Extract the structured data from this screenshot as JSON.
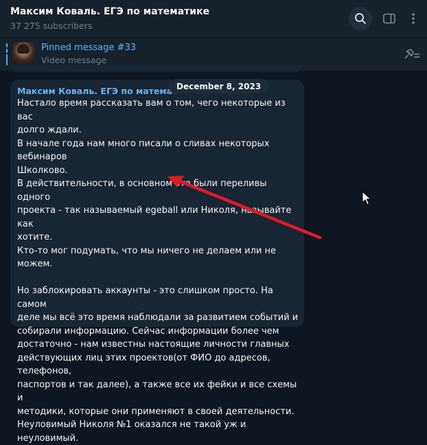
{
  "header": {
    "channel_name": "Максим Коваль. ЕГЭ по математике",
    "subscribers": "37 275 subscribers",
    "icons": [
      "search-icon",
      "sidebar-toggle-icon",
      "more-vertical-icon"
    ]
  },
  "pinned": {
    "title": "Pinned message #33",
    "subtitle": "Video message",
    "icon": "unpin-icon"
  },
  "date_badge": "December 8, 2023",
  "message": {
    "sender": "Максим Коваль. ЕГЭ по математике",
    "lines": [
      "Настало время рассказать вам о том, чего некоторые из вас",
      "долго ждали.",
      "В начале года нам много писали о сливах некоторых вебинаров",
      "Школково.",
      "В действительности, в основном это были переливы одного",
      "проекта - так называемый egeball или Николя, называйте как",
      "хотите.",
      "Кто-то мог подумать, что мы ничего не делаем или не можем.",
      "",
      "Но заблокировать аккаунты - это слишком просто. На самом",
      "деле мы всё это время наблюдали за развитием событий и",
      "собирали информацию. Сейчас информации более чем",
      "достаточно - нам известны настоящие личности главных",
      "действующих лиц этих проектов(от ФИО до адресов, телефонов,",
      "паспортов и так далее), а также все их фейки и все схемы и",
      "методики, которые они применяют в своей деятельности.",
      "Неуловимый Николя №1 оказался не такой уж и неуловимый."
    ]
  },
  "colors": {
    "background": "#0e1621",
    "header": "#17212b",
    "bubble": "#182533",
    "accent": "#6ab2f2",
    "annotation_arrow": "#e01b24"
  }
}
